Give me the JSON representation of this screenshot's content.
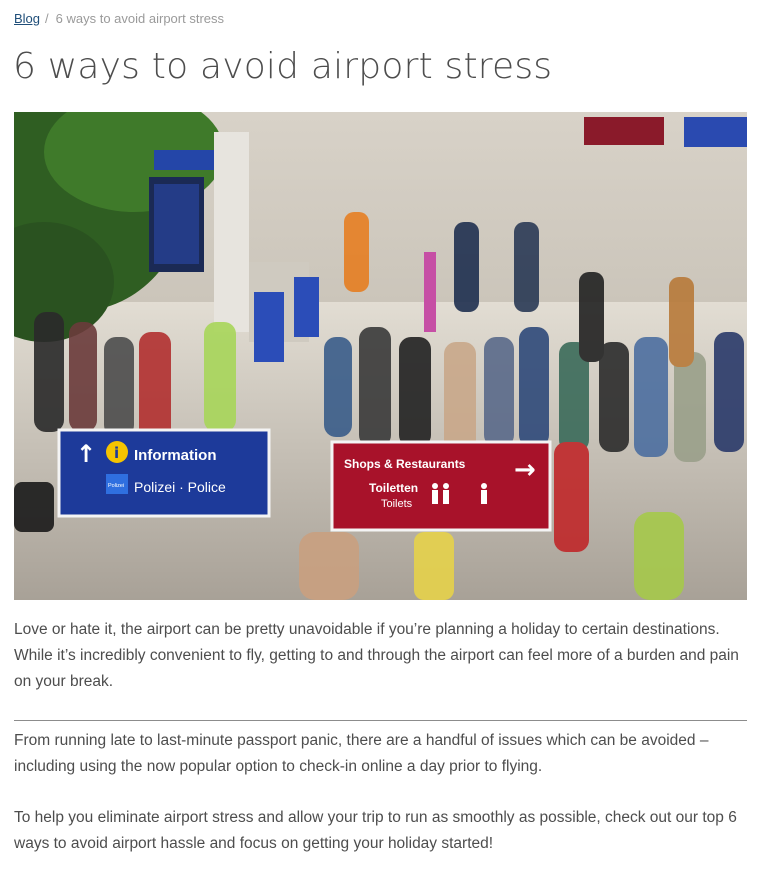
{
  "breadcrumb": {
    "root_label": "Blog",
    "current_label": "6 ways to avoid airport stress"
  },
  "article": {
    "title": "6 ways to avoid airport stress",
    "paragraphs": [
      "Love or hate it, the airport can be pretty unavoidable if you’re planning a holiday to certain destinations. While it’s incredibly convenient to fly, getting to and through the airport can feel more of a burden and pain on your break.",
      "From running late to last-minute passport panic, there are a handful of issues which can be avoided – including using the now popular option to check-in online a day prior to flying.",
      "To help you eliminate airport stress and allow your trip to run as smoothly as possible, check out our top 6 ways to avoid airport hassle and focus on getting your holiday started!"
    ]
  },
  "hero_image": {
    "info_sign": {
      "arrow": "↑",
      "info_glyph": "i",
      "info_label": "Information",
      "polizei_badge": "Polizei",
      "police_label": "Polizei · Police"
    },
    "shops_sign": {
      "shops_label": "Shops & Restaurants",
      "toilets_label": "Toiletten",
      "toilets_sub": "Toilets",
      "arrow": "→"
    },
    "colors": {
      "info_sign_blue": "#1d3a9a",
      "shops_sign_red": "#a8122a",
      "info_yellow": "#f5c400"
    }
  }
}
